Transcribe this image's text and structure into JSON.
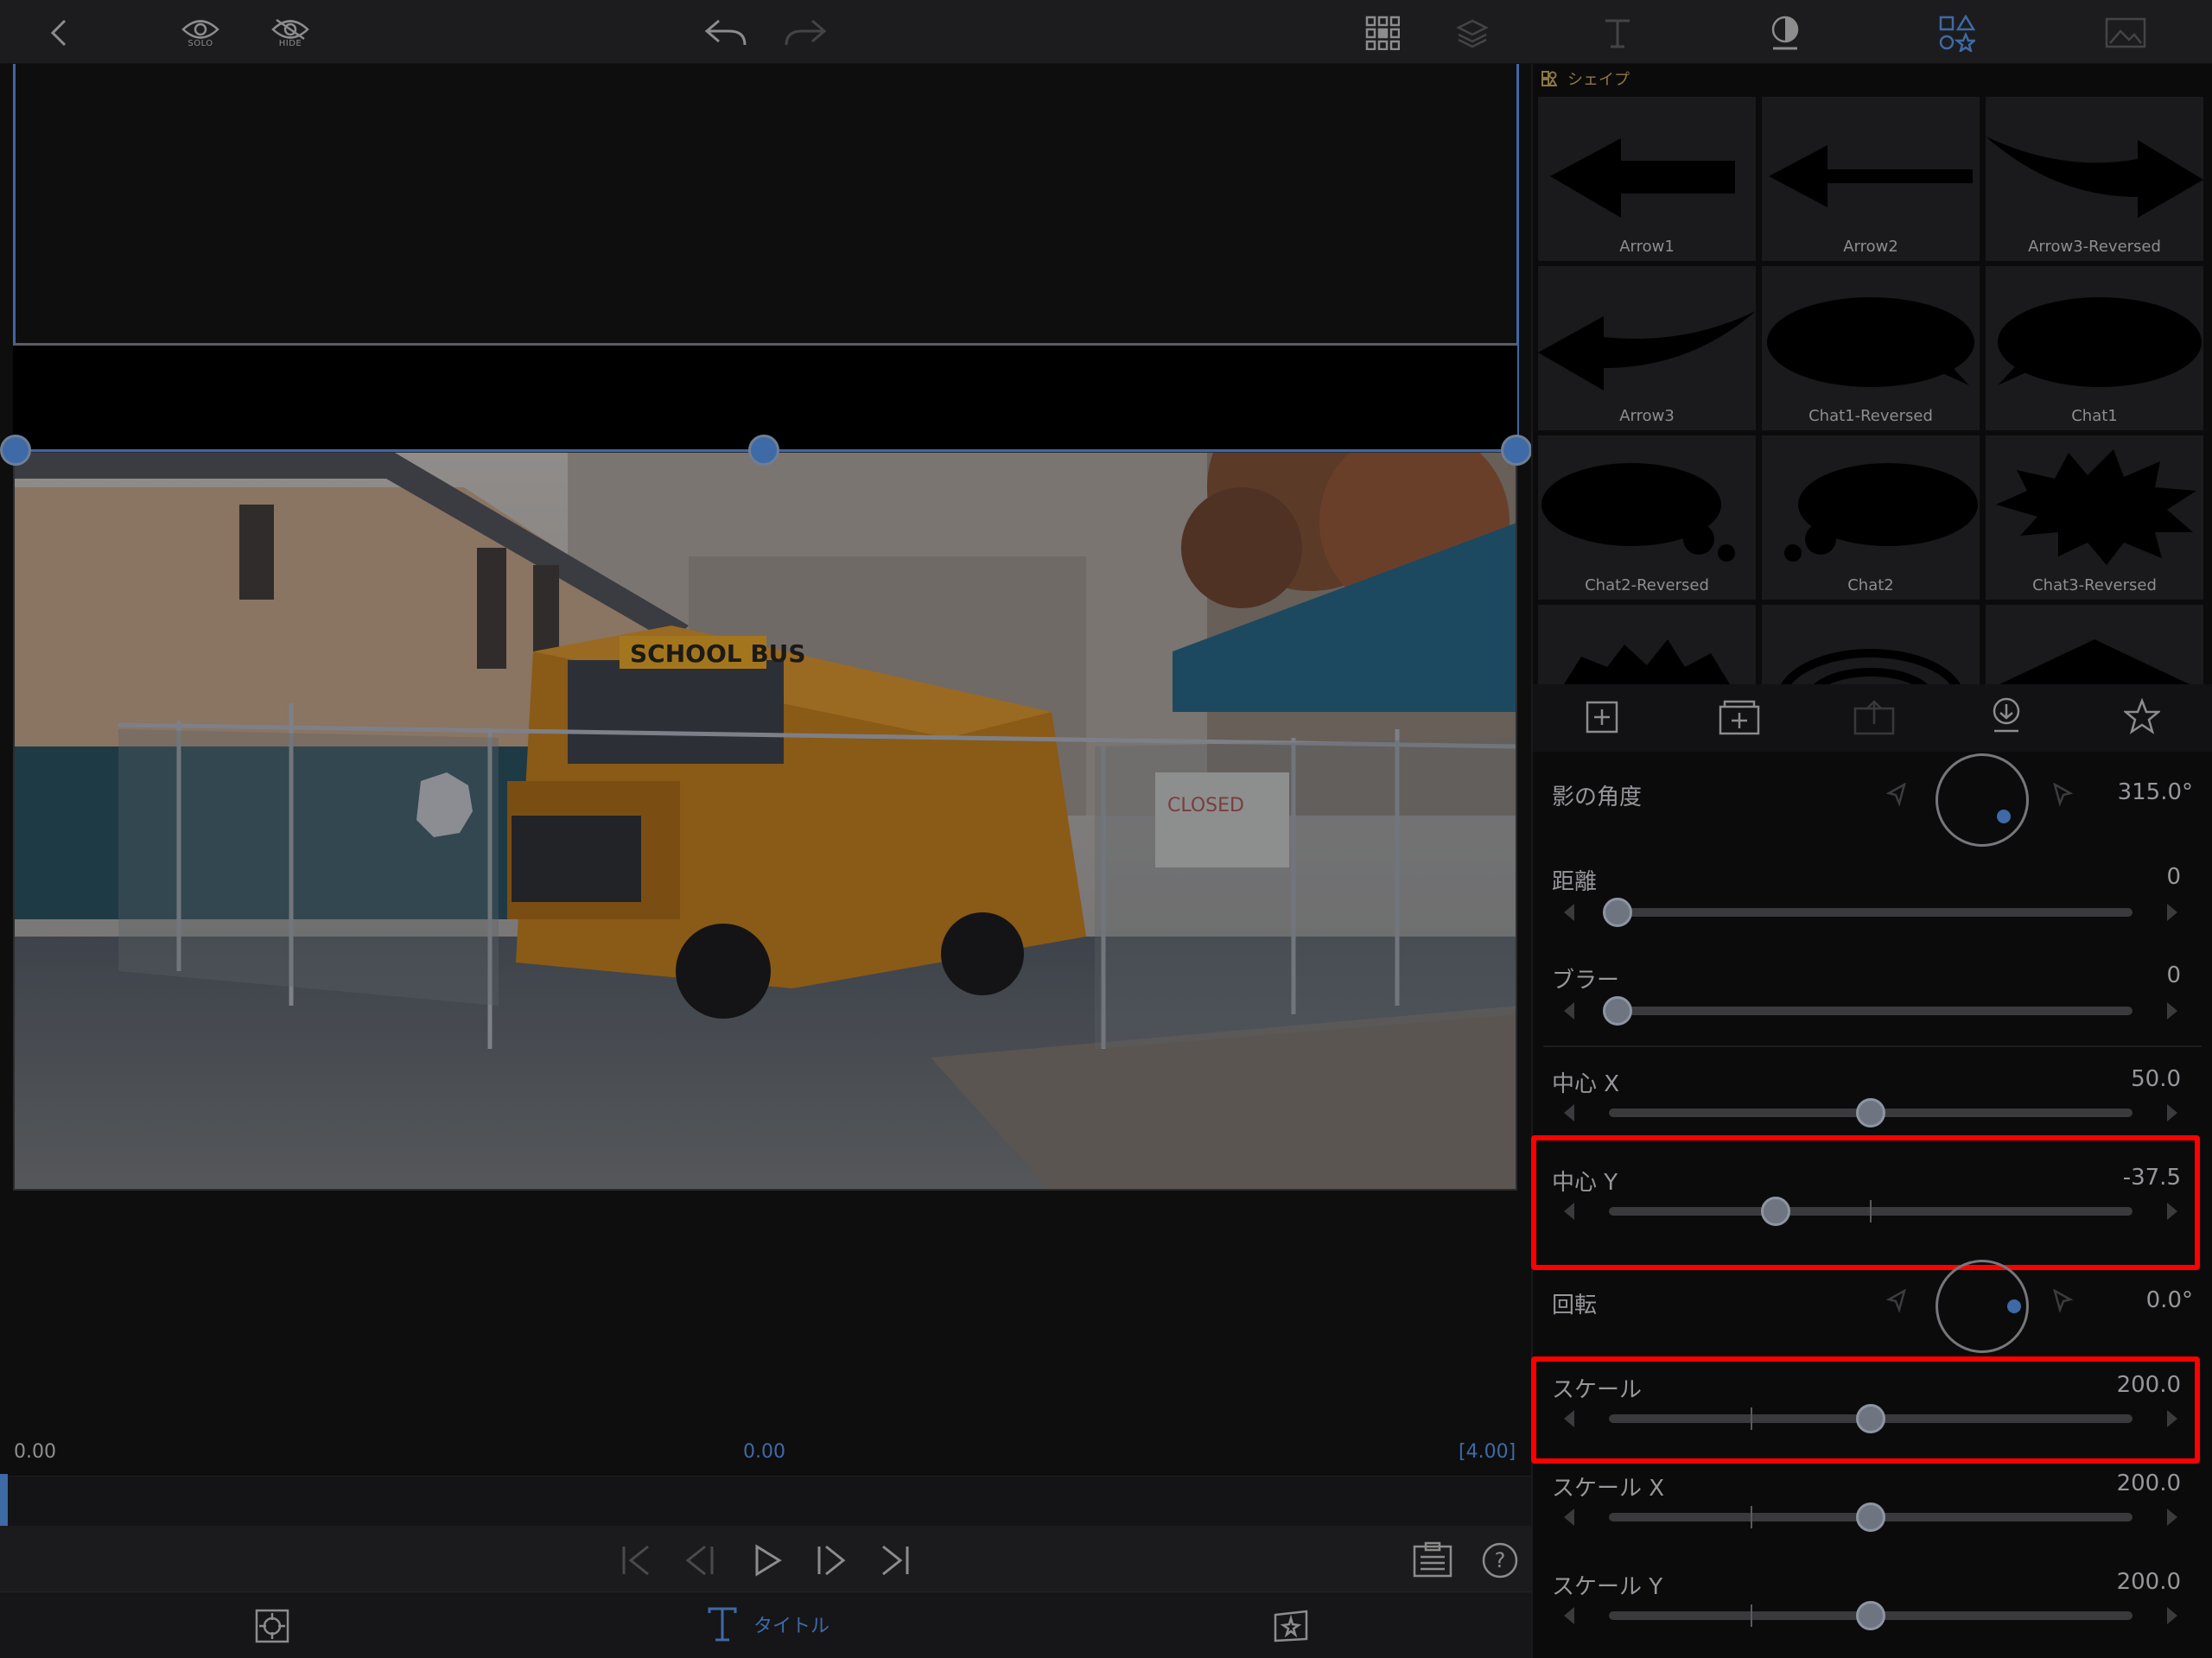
{
  "toolbar": {
    "solo_label": "SOLO",
    "hide_label": "HIDE"
  },
  "preview": {
    "time_left": "0.00",
    "time_center": "0.00",
    "time_right": "[4.00]",
    "video_sign_bus": "SCHOOL BUS",
    "video_sign_closed": "CLOSED"
  },
  "bottom_tabs": {
    "title_label": "タイトル"
  },
  "shapes": {
    "header": "シェイプ",
    "tiles": [
      "Arrow1",
      "Arrow2",
      "Arrow3-Reversed",
      "Arrow3",
      "Chat1-Reversed",
      "Chat1",
      "Chat2-Reversed",
      "Chat2",
      "Chat3-Reversed"
    ]
  },
  "properties": {
    "shadow_angle": {
      "label": "影の角度",
      "value": "315.0°"
    },
    "distance": {
      "label": "距離",
      "value": "0",
      "level": 0.0
    },
    "blur": {
      "label": "ブラー",
      "value": "0",
      "level": 0.0
    },
    "center_x": {
      "label": "中心 X",
      "value": "50.0",
      "level": 0.5
    },
    "center_y": {
      "label": "中心 Y",
      "value": "-37.5",
      "level": 0.3125
    },
    "rotation": {
      "label": "回転",
      "value": "0.0°"
    },
    "scale": {
      "label": "スケール",
      "value": "200.0",
      "level": 0.5
    },
    "scale_x": {
      "label": "スケール X",
      "value": "200.0",
      "level": 0.5
    },
    "scale_y": {
      "label": "スケール Y",
      "value": "200.0",
      "level": 0.5
    }
  },
  "colors": {
    "accent": "#3e6aa6",
    "highlight": "#ff0000"
  }
}
